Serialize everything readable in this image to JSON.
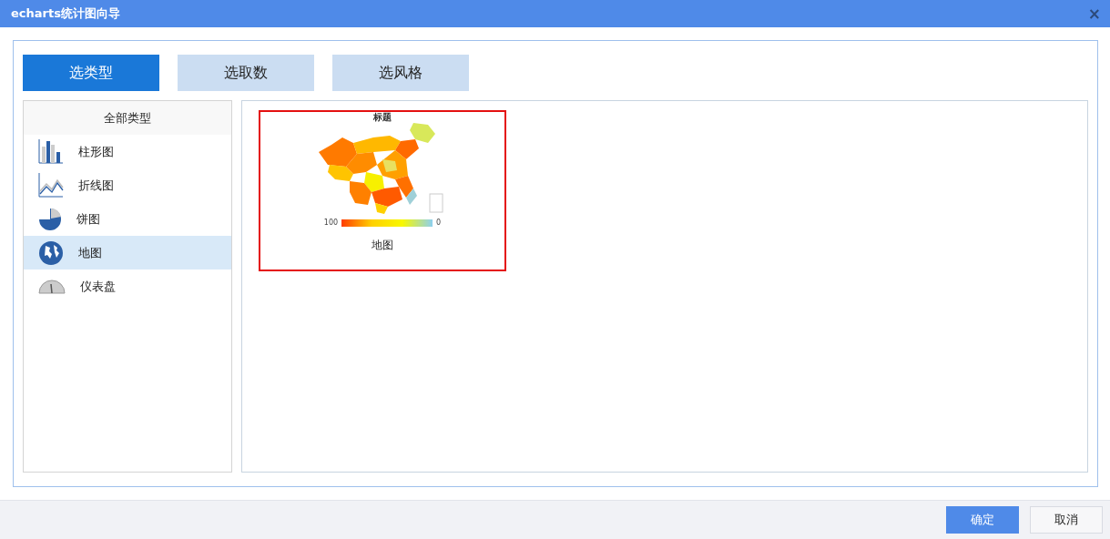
{
  "window": {
    "title": "echarts统计图向导",
    "close": "×"
  },
  "tabs": [
    {
      "label": "选类型",
      "selected": true
    },
    {
      "label": "选取数",
      "selected": false
    },
    {
      "label": "选风格",
      "selected": false
    }
  ],
  "sidebar": {
    "header": "全部类型",
    "items": [
      {
        "label": "柱形图",
        "kind": "bar",
        "selected": false
      },
      {
        "label": "折线图",
        "kind": "line",
        "selected": false
      },
      {
        "label": "饼图",
        "kind": "pie",
        "selected": false
      },
      {
        "label": "地图",
        "kind": "map",
        "selected": true
      },
      {
        "label": "仪表盘",
        "kind": "gauge",
        "selected": false
      }
    ]
  },
  "gallery": [
    {
      "chart_title": "标题",
      "legend_max": "100",
      "legend_min": "0",
      "caption": "地图",
      "selected": true
    }
  ],
  "buttons": [
    {
      "label": "确定",
      "kind": "primary"
    },
    {
      "label": "取消",
      "kind": "secondary"
    }
  ]
}
